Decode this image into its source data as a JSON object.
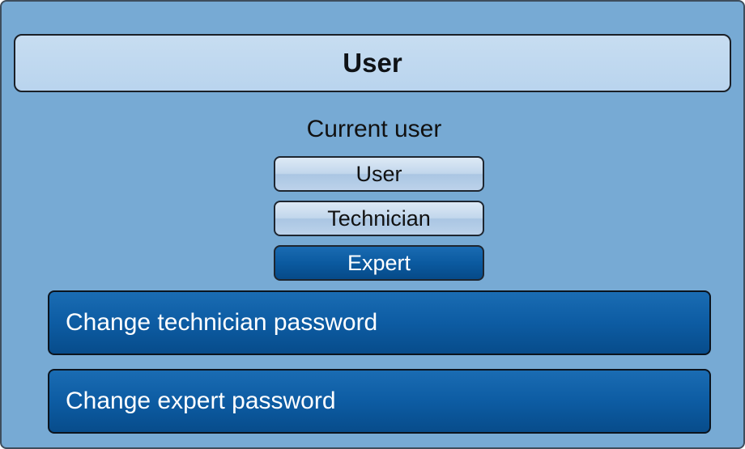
{
  "header": {
    "title": "User"
  },
  "current_user": {
    "label": "Current user",
    "options": [
      {
        "label": "User",
        "selected": false
      },
      {
        "label": "Technician",
        "selected": false
      },
      {
        "label": "Expert",
        "selected": true
      }
    ]
  },
  "actions": {
    "change_technician_password": "Change technician password",
    "change_expert_password": "Change expert password"
  },
  "colors": {
    "background": "#77aad4",
    "selected_button": "#0b5aa0",
    "unselected_button": "#c2d7ec",
    "title_bar": "#c7ddf1"
  }
}
